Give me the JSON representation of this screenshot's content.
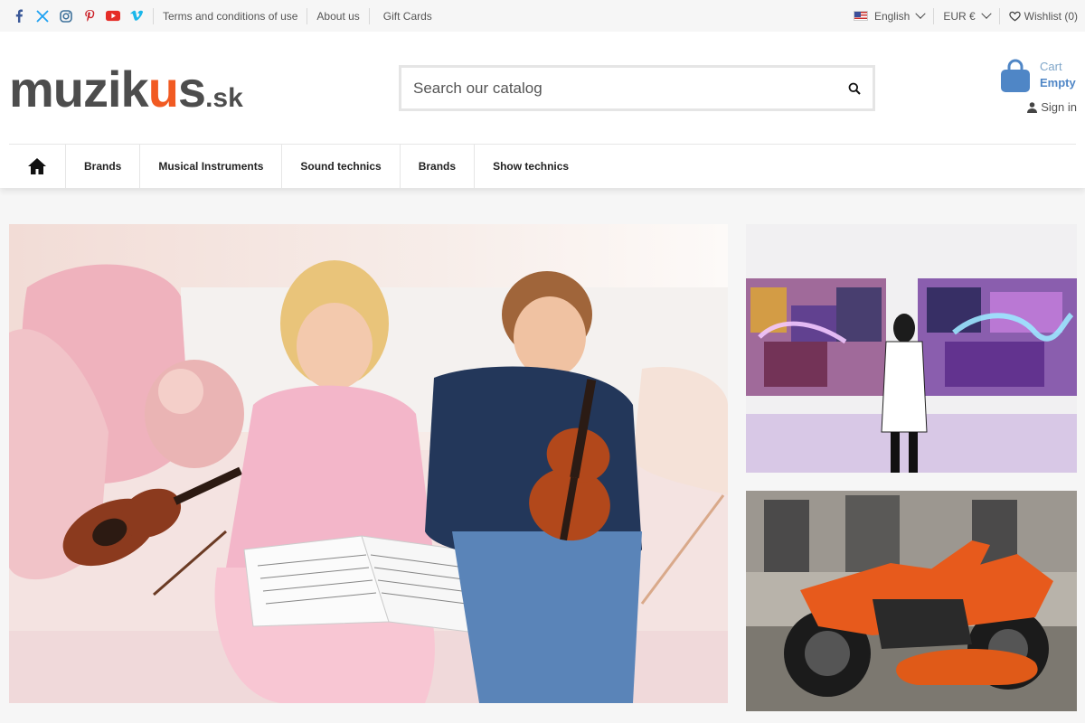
{
  "topbar": {
    "social": [
      {
        "icon": "facebook-icon",
        "color": "#3b5998"
      },
      {
        "icon": "x-twitter-icon",
        "color": "#1da1f2"
      },
      {
        "icon": "instagram-icon",
        "color": "#3f729b"
      },
      {
        "icon": "pinterest-icon",
        "color": "#cb2027"
      },
      {
        "icon": "youtube-icon",
        "color": "#e52d27"
      },
      {
        "icon": "vimeo-icon",
        "color": "#1ab7ea"
      }
    ],
    "links": [
      "Terms and conditions of use",
      "About us",
      "Gift Cards"
    ],
    "language": "English",
    "currency": "EUR €",
    "wishlist": "Wishlist (0)"
  },
  "header": {
    "logo_text": "muzik",
    "logo_accent": "u",
    "logo_end": "s",
    "logo_tld": ".sk",
    "logo_accent_color": "#f15a22",
    "search_placeholder": "Search our catalog",
    "cart_label": "Cart",
    "cart_status": "Empty",
    "signin": "Sign in"
  },
  "nav": {
    "items": [
      "Brands",
      "Musical Instruments",
      "Sound technics",
      "Brands",
      "Show technics"
    ]
  }
}
